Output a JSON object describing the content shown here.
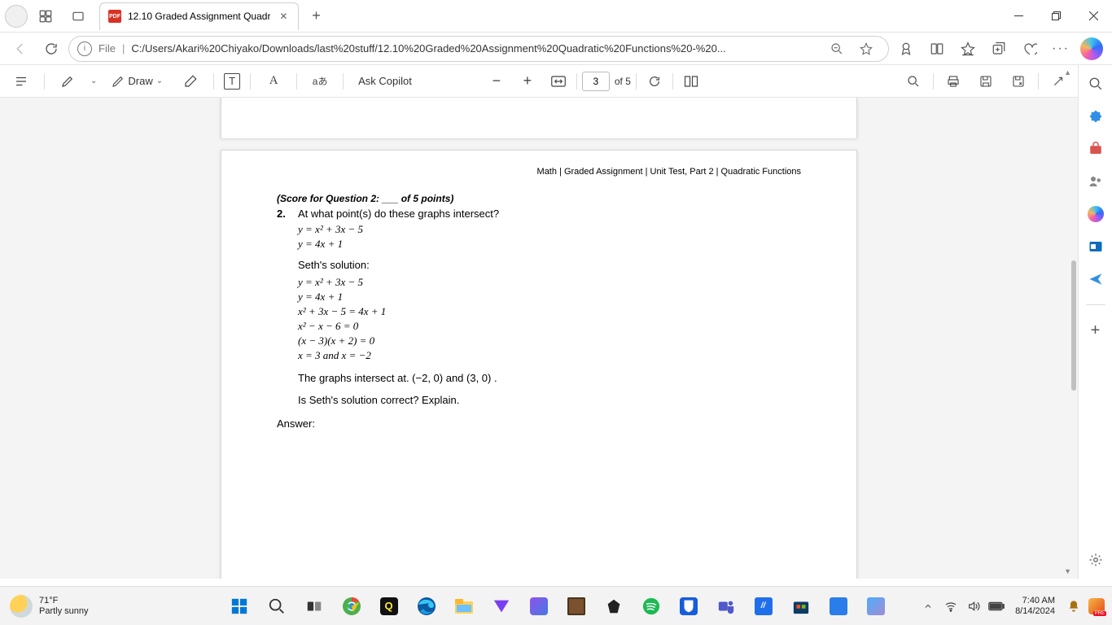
{
  "titlebar": {
    "tab_title": "12.10 Graded Assignment Quadr",
    "favicon_text": "PDF"
  },
  "addressbar": {
    "scheme": "File",
    "path": "C:/Users/Akari%20Chiyako/Downloads/last%20stuff/12.10%20Graded%20Assignment%20Quadratic%20Functions%20-%20...",
    "info_label": "i"
  },
  "pdf_toolbar": {
    "draw_label": "Draw",
    "ask_copilot": "Ask Copilot",
    "page_current": "3",
    "page_of": "of 5",
    "text_tool": "T",
    "font_tool": "A",
    "translate_tool": "aあ"
  },
  "document": {
    "header": "Math | Graded Assignment | Unit Test, Part 2 | Quadratic Functions",
    "score_line": "(Score for Question 2: ___ of 5 points)",
    "q_num": "2.",
    "q_text": "At what point(s) do these graphs intersect?",
    "eq1": "y = x² + 3x − 5",
    "eq2": "y = 4x + 1",
    "seth_label": "Seth's solution:",
    "s1": "y = x² + 3x − 5",
    "s2": "y = 4x + 1",
    "s3": "x² + 3x − 5 = 4x + 1",
    "s4": "x² − x − 6 = 0",
    "s5": "(x − 3)(x + 2) = 0",
    "s6": "x = 3 and x = −2",
    "conclusion": "The graphs intersect at. (−2, 0)  and  (3, 0) .",
    "ask": "Is Seth's solution correct? Explain.",
    "answer_label": "Answer:"
  },
  "weather": {
    "temp": "71°F",
    "cond": "Partly sunny"
  },
  "clock": {
    "time": "7:40 AM",
    "date": "8/14/2024"
  }
}
